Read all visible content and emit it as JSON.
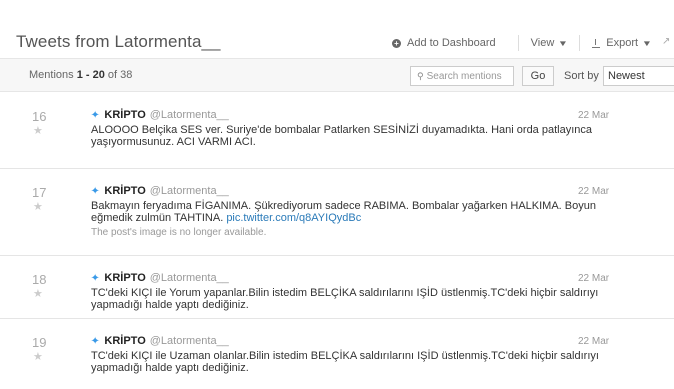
{
  "header": {
    "title": "Tweets from Latormenta__",
    "add_dashboard": "Add to Dashboard",
    "view": "View",
    "export": "Export"
  },
  "toolbar": {
    "mentions_prefix": "Mentions ",
    "mentions_range": "1 - 20",
    "mentions_suffix": " of 38",
    "search_placeholder": "Search mentions",
    "go": "Go",
    "sort_label": "Sort by",
    "sort_value": "Newest"
  },
  "mentions": [
    {
      "num": "16",
      "author": "KRİPTO",
      "handle": "@Latormenta__",
      "date": "22 Mar",
      "text": "ALOOOO Belçika SES ver. Suriye'de bombalar Patlarken SESİNİZİ duyamadıkta. Hani orda patlayınca yaşıyormusunuz. ACI VARMI ACI.",
      "link": "",
      "note": ""
    },
    {
      "num": "17",
      "author": "KRİPTO",
      "handle": "@Latormenta__",
      "date": "22 Mar",
      "text": "Bakmayın feryadıma FİGANIMA. Şükrediyorum sadece RABIMA. Bombalar yağarken HALKIMA. Boyun eğmedik zulmün TAHTINA.",
      "link": "pic.twitter.com/q8AYIQydBc",
      "note": "The post's image is no longer available."
    },
    {
      "num": "18",
      "author": "KRİPTO",
      "handle": "@Latormenta__",
      "date": "22 Mar",
      "text": "TC'deki KIÇI ile Yorum yapanlar.Bilin istedim BELÇİKA saldırılarını IŞİD üstlenmiş.TC'deki hiçbir saldırıyı yapmadığı halde yaptı dediğiniz.",
      "link": "",
      "note": ""
    },
    {
      "num": "19",
      "author": "KRİPTO",
      "handle": "@Latormenta__",
      "date": "22 Mar",
      "text": "TC'deki KIÇI ile Uzaman olanlar.Bilin istedim BELÇİKA saldırılarını IŞİD üstlenmiş.TC'deki hiçbir saldırıyı yapmadığı halde yaptı dediğiniz.",
      "link": "",
      "note": ""
    }
  ]
}
